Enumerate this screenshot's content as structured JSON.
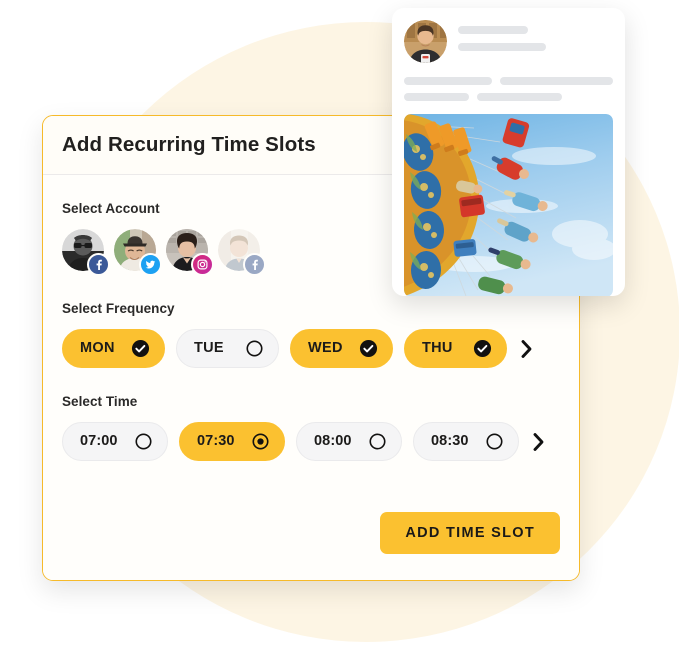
{
  "dialog": {
    "title": "Add Recurring Time Slots",
    "sections": {
      "account": {
        "label": "Select Account"
      },
      "frequency": {
        "label": "Select Frequency"
      },
      "time": {
        "label": "Select Time"
      }
    },
    "submit_label": "ADD TIME SLOT"
  },
  "accounts": [
    {
      "name": "account-avatar-1",
      "network": "facebook",
      "badge_color": "#3b5998",
      "selected": true,
      "enabled": true
    },
    {
      "name": "account-avatar-2",
      "network": "twitter",
      "badge_color": "#1da1f2",
      "selected": true,
      "enabled": true
    },
    {
      "name": "account-avatar-3",
      "network": "instagram",
      "badge_color": "#c32aa3",
      "selected": true,
      "enabled": true
    },
    {
      "name": "account-avatar-4",
      "network": "facebook",
      "badge_color": "#9aa8c4",
      "selected": false,
      "enabled": false
    }
  ],
  "frequency": {
    "options": [
      {
        "label": "MON",
        "selected": true
      },
      {
        "label": "TUE",
        "selected": false
      },
      {
        "label": "WED",
        "selected": true
      },
      {
        "label": "THU",
        "selected": true
      }
    ],
    "next_label": "›"
  },
  "time": {
    "options": [
      {
        "label": "07:00",
        "selected": false
      },
      {
        "label": "07:30",
        "selected": true
      },
      {
        "label": "08:00",
        "selected": false
      },
      {
        "label": "08:30",
        "selected": false
      }
    ],
    "next_label": "›"
  },
  "post_preview": {
    "author_avatar": "post-author-avatar",
    "head_bars": [
      70,
      88
    ],
    "body_bars": [
      [
        88,
        115
      ],
      [
        65,
        85
      ]
    ],
    "image_alt": "carnival swing ride against blue sky"
  },
  "colors": {
    "accent": "#fbc130",
    "card_border": "#f6ba2a",
    "blob": "#fdf5e4",
    "text": "#1c1b1a",
    "pill_off_bg": "#f5f5f6",
    "placeholder_bar": "#e3e5e8"
  }
}
